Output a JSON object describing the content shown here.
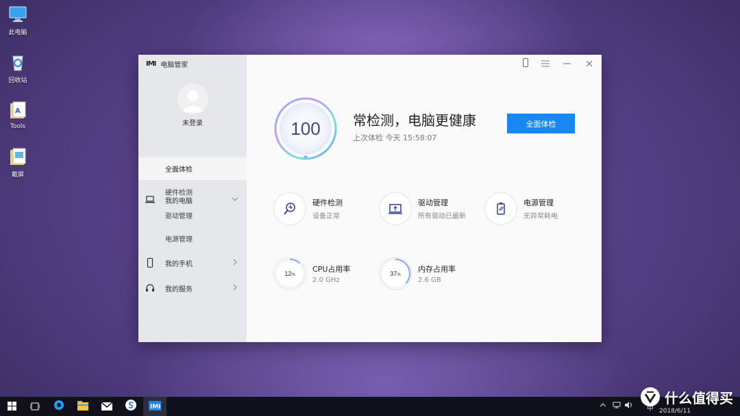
{
  "desktop": {
    "icons": [
      {
        "label": "此电脑",
        "icon": "computer-icon"
      },
      {
        "label": "回收站",
        "icon": "recycle-bin-icon"
      },
      {
        "label": "Tools",
        "icon": "folder-tools-icon"
      },
      {
        "label": "截屏",
        "icon": "folder-screenshot-icon"
      }
    ]
  },
  "window": {
    "logo": "IMI",
    "title": "电脑管家",
    "controls": [
      "phone-icon",
      "menu-icon",
      "minimize-icon",
      "close-icon"
    ]
  },
  "sidebar": {
    "login": "未登录",
    "groups": [
      {
        "label": "我的电脑",
        "icon": "laptop-icon",
        "expanded": true
      },
      {
        "label": "我的手机",
        "icon": "phone-icon",
        "expanded": false
      },
      {
        "label": "我的服务",
        "icon": "headset-icon",
        "expanded": false
      }
    ],
    "subitems": [
      "全面体检",
      "硬件检测",
      "驱动管理",
      "电源管理"
    ],
    "active_subitem": "全面体检"
  },
  "main": {
    "score": "100",
    "headline": "常检测，电脑更健康",
    "last_check": "上次体检 今天 15:58:07",
    "scan_button": "全面体检",
    "features": [
      {
        "title": "硬件检测",
        "subtitle": "设备正常",
        "icon": "hardware-scan-icon"
      },
      {
        "title": "驱动管理",
        "subtitle": "所有驱动已最新",
        "icon": "driver-icon"
      },
      {
        "title": "电源管理",
        "subtitle": "无异常耗电",
        "icon": "battery-icon"
      }
    ],
    "usage": [
      {
        "title": "CPU占用率",
        "value": "12",
        "unit": "%",
        "fraction": 0.12,
        "detail": "2.0 GHz"
      },
      {
        "title": "内存占用率",
        "value": "37",
        "unit": "%",
        "fraction": 0.37,
        "detail": "2.6 GB"
      }
    ]
  },
  "taskbar": {
    "items": [
      "windows-start-icon",
      "task-view-icon",
      "browser-icon",
      "file-explorer-icon",
      "mail-icon",
      "sogou-icon",
      "pc-manager-icon"
    ],
    "tray": {
      "ime": "中",
      "date": "2018/6/11"
    }
  },
  "watermark": {
    "text": "什么值得买"
  },
  "colors": {
    "accent": "#1a86f2",
    "sidebar": "#e6e7ea",
    "taskbar": "#10111a"
  }
}
